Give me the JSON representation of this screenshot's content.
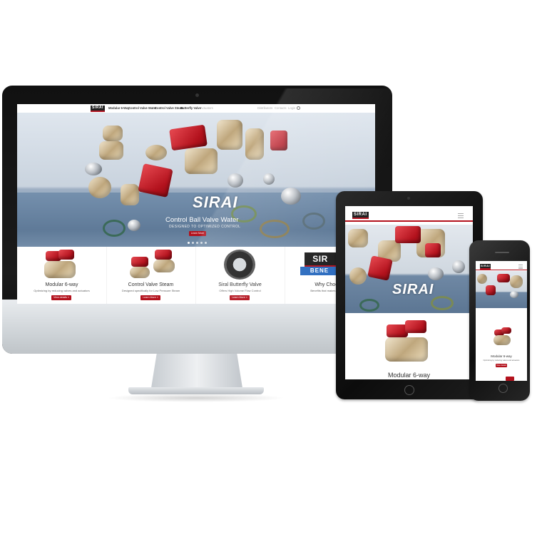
{
  "desktop": {
    "nav": {
      "logo": "SIRAI",
      "links": [
        "Modular 6-Way",
        "Control Valve Water",
        "Control Valve Steam",
        "Butterfly Valve",
        "Actuators"
      ],
      "right_links": [
        "Distributors",
        "Contacts",
        "Login"
      ]
    },
    "hero": {
      "brand": "SIRAI",
      "title": "Control Ball Valve Water",
      "subtitle": "DESIGNED TO OPTIMIZED CONTROL",
      "button": "Learn More",
      "slides": 5
    },
    "products": [
      {
        "title": "Modular 6-way",
        "desc": "Optimizing by reducing valves and actuators",
        "button": "View details »"
      },
      {
        "title": "Control Valve Steam",
        "desc": "Designed specifically for Low Pressure Steam",
        "button": "Learn More »"
      },
      {
        "title": "Siral Butterfly Valve",
        "desc": "Offers High Volume Flow Control",
        "button": "Learn More »"
      },
      {
        "title": "Why Choos",
        "desc": "Benefits that makes Siral",
        "button": "Learn M"
      }
    ]
  },
  "tablet": {
    "logo": "SIRAI",
    "hero_brand": "SIRAI",
    "product_title": "Modular 6-way"
  },
  "phone": {
    "logo": "SIRAI",
    "product_title": "Modular 6-way",
    "product_desc": "Optimizing by reducing valves and actuators",
    "button": "View details"
  },
  "colors": {
    "brand_red": "#b3121d",
    "dark_frame": "#111111",
    "silver": "#cfd4d8"
  }
}
